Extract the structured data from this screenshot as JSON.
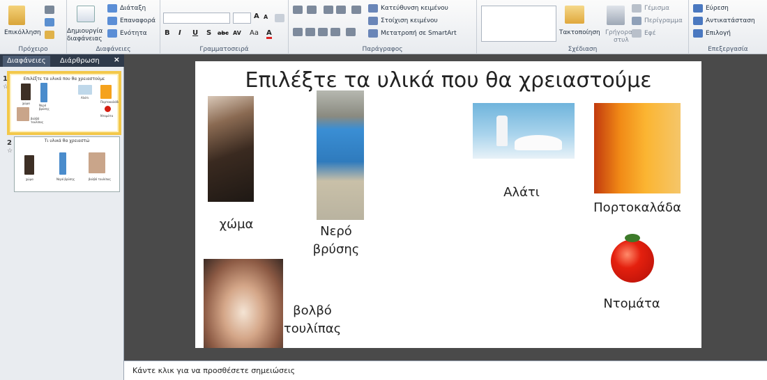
{
  "ribbon": {
    "clipboard": {
      "paste": "Επικόλληση",
      "group": "Πρόχειρο"
    },
    "slides": {
      "new_slide_line1": "Δημιουργία",
      "new_slide_line2": "διαφάνειας",
      "layout": "Διάταξη",
      "reset": "Επαναφορά",
      "section": "Ενότητα",
      "group": "Διαφάνειες"
    },
    "font": {
      "group": "Γραμματοσειρά",
      "bold": "B",
      "italic": "I",
      "underline": "U",
      "shadow": "S",
      "strike": "abc",
      "spacing": "AV",
      "case": "Aa",
      "color": "A"
    },
    "paragraph": {
      "text_direction": "Κατεύθυνση κειμένου",
      "align_text": "Στοίχιση κειμένου",
      "smartart": "Μετατροπή σε SmartArt",
      "group": "Παράγραφος"
    },
    "drawing": {
      "arrange": "Τακτοποίηση",
      "quick_styles_1": "Γρήγορα",
      "quick_styles_2": "στυλ",
      "fill": "Γέμισμα",
      "outline": "Περίγραμμα",
      "effects": "Εφέ",
      "group": "Σχέδιαση"
    },
    "editing": {
      "find": "Εύρεση",
      "replace": "Αντικατάσταση",
      "select": "Επιλογή",
      "group": "Επεξεργασία"
    }
  },
  "panel": {
    "tab_slides": "Διαφάνειες",
    "tab_outline": "Διάρθρωση",
    "close": "×",
    "slide1": {
      "num": "1",
      "title": "Επιλέξτε τα υλικά που θα χρειαστούμε",
      "labels": [
        "χώμα",
        "Νερό βρύσης",
        "Αλάτι",
        "Πορτοκαλάδα",
        "βολβό τουλίπας",
        "Ντομάτα"
      ]
    },
    "slide2": {
      "num": "2",
      "title": "Τι υλικά θα χρειαστώ",
      "labels": [
        "χώμα",
        "Νερό βρύσης",
        "βολβό τουλίπας"
      ]
    }
  },
  "slide": {
    "title": "Επιλέξτε τα υλικά που θα χρειαστούμε",
    "captions": {
      "soil": "χώμα",
      "water_1": "Νερό",
      "water_2": "βρύσης",
      "salt": "Αλάτι",
      "orange": "Πορτοκαλάδα",
      "bulb_1": "βολβό",
      "bulb_2": "τουλίπας",
      "tomato": "Ντομάτα"
    }
  },
  "notes": {
    "placeholder": "Κάντε κλικ για να προσθέσετε σημειώσεις"
  }
}
